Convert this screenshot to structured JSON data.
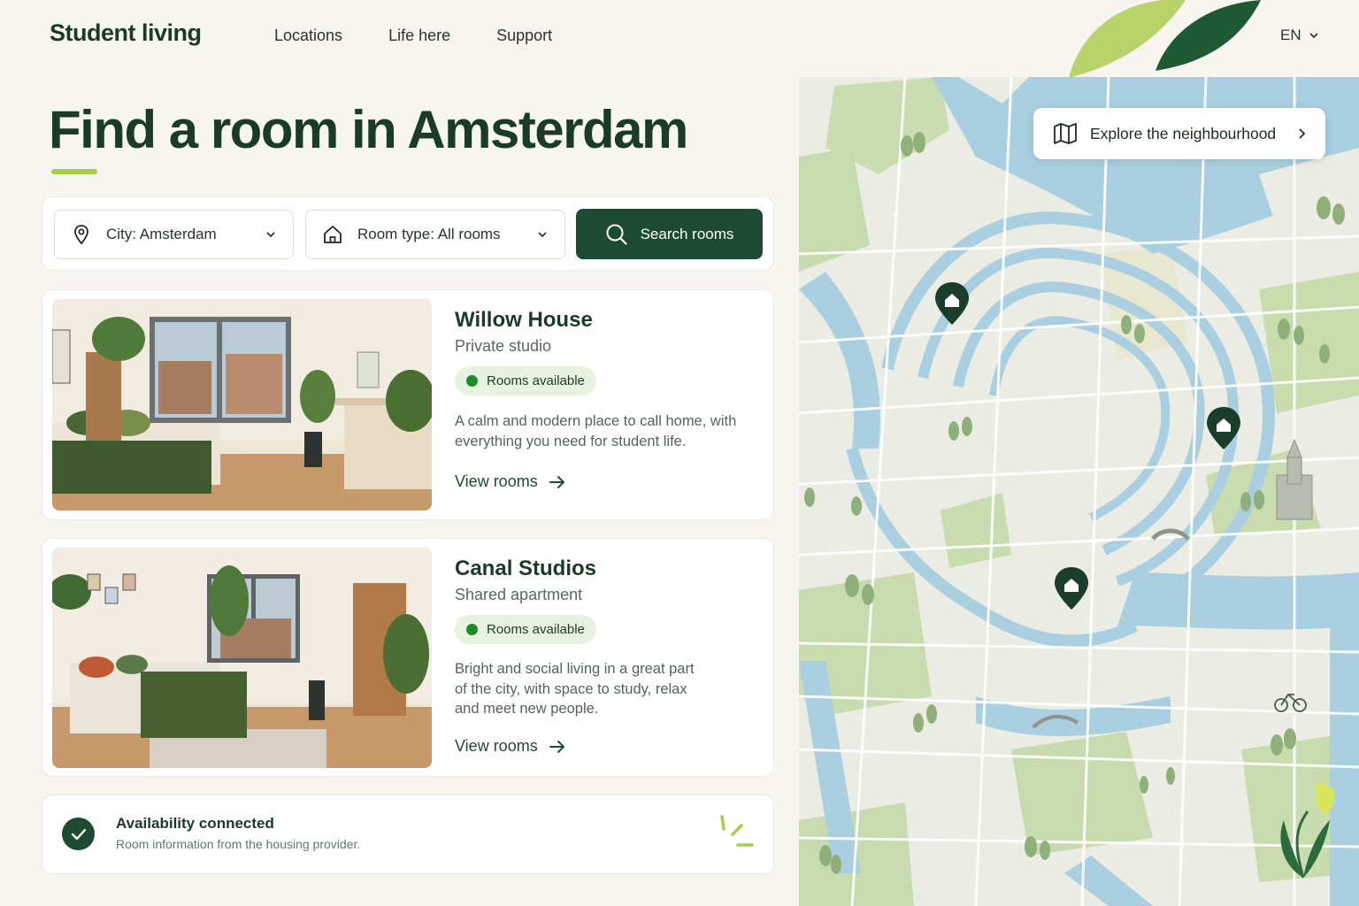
{
  "header": {
    "logo": "Student living",
    "nav": [
      "Locations",
      "Life here",
      "Support"
    ],
    "language": "EN"
  },
  "hero": {
    "title": "Find a room in Amsterdam"
  },
  "search": {
    "city_label": "City: Amsterdam",
    "room_type_label": "Room type: All rooms",
    "button_label": "Search rooms"
  },
  "listings": [
    {
      "name": "Willow House",
      "type": "Private studio",
      "status": "Rooms available",
      "description": "A calm and modern place to call home, with everything you need for student life.",
      "link": "View rooms"
    },
    {
      "name": "Canal Studios",
      "type": "Shared apartment",
      "status": "Rooms available",
      "description": "Bright and social living in a great part of the city, with space to study, relax and meet new people.",
      "link": "View rooms"
    }
  ],
  "availability": {
    "title": "Availability connected",
    "subtitle": "Room information from the housing provider."
  },
  "map": {
    "explore_label": "Explore the neighbourhood",
    "markers": 3
  },
  "colors": {
    "brand_dark": "#1d4a32",
    "accent_lime": "#a8cc4a",
    "available_dot": "#1e8a2e",
    "water": "#a9cfe0",
    "park": "#c9dcae"
  }
}
